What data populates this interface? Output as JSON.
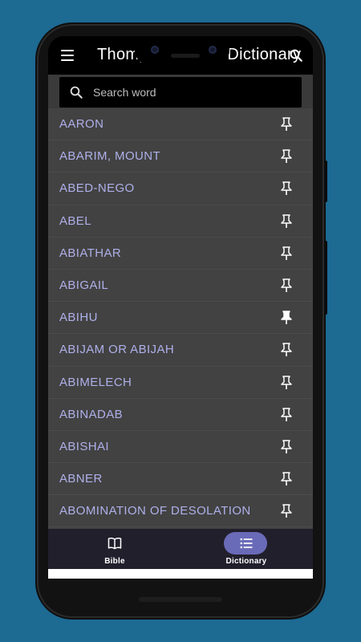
{
  "app": {
    "title": "Thompson Chain Dictionary"
  },
  "search": {
    "placeholder": "Search word"
  },
  "entries": [
    {
      "label": "AARON",
      "pinned": false
    },
    {
      "label": "ABARIM, MOUNT",
      "pinned": false
    },
    {
      "label": "ABED-NEGO",
      "pinned": false
    },
    {
      "label": "ABEL",
      "pinned": false
    },
    {
      "label": "ABIATHAR",
      "pinned": false
    },
    {
      "label": "ABIGAIL",
      "pinned": false
    },
    {
      "label": "ABIHU",
      "pinned": true
    },
    {
      "label": "ABIJAM OR ABIJAH",
      "pinned": false
    },
    {
      "label": "ABIMELECH",
      "pinned": false
    },
    {
      "label": "ABINADAB",
      "pinned": false
    },
    {
      "label": "ABISHAI",
      "pinned": false
    },
    {
      "label": "ABNER",
      "pinned": false
    },
    {
      "label": "ABOMINATION OF DESOLATION",
      "pinned": false
    }
  ],
  "bottom_nav": {
    "bible_label": "Bible",
    "dictionary_label": "Dictionary",
    "active": "dictionary"
  },
  "colors": {
    "background": "#1d6a93",
    "entry_text": "#aeb0ea",
    "list_bg": "#424242",
    "nav_bg": "#221f2d",
    "active_pill": "#6a6bb8"
  }
}
